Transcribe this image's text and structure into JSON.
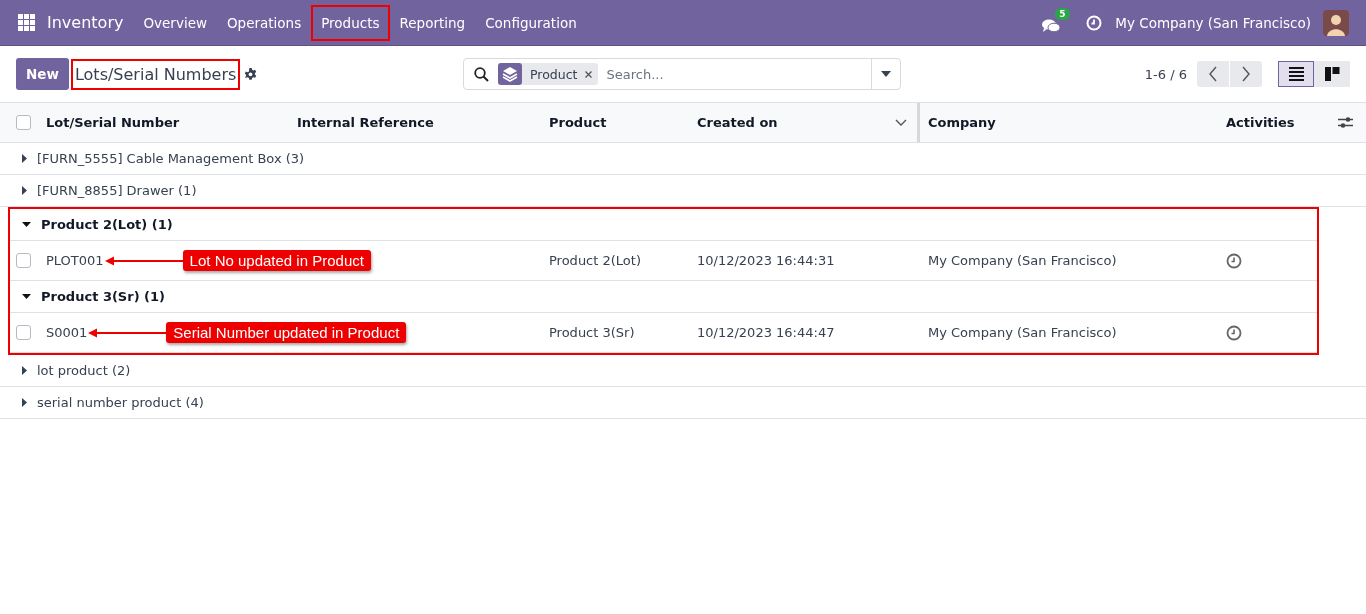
{
  "navbar": {
    "app": "Inventory",
    "menu": [
      {
        "label": "Overview",
        "highlighted": false
      },
      {
        "label": "Operations",
        "highlighted": false
      },
      {
        "label": "Products",
        "highlighted": true
      },
      {
        "label": "Reporting",
        "highlighted": false
      },
      {
        "label": "Configuration",
        "highlighted": false
      }
    ],
    "messages_badge": "5",
    "company": "My Company (San Francisco)"
  },
  "control_panel": {
    "new_button": "New",
    "title": "Lots/Serial Numbers",
    "title_highlighted": true,
    "search": {
      "facet": "Product",
      "placeholder": "Search..."
    },
    "pager": "1-6 / 6",
    "views": [
      {
        "kind": "list",
        "selected": true
      },
      {
        "kind": "kanban",
        "selected": false
      }
    ]
  },
  "table": {
    "select_all_checked": false,
    "columns": [
      "Lot/Serial Number",
      "Internal Reference",
      "Product",
      "Created on",
      "Company",
      "Activities"
    ],
    "groups": [
      {
        "label": "[FURN_5555] Cable Management Box (3)",
        "expanded": false,
        "highlighted": false
      },
      {
        "label": "[FURN_8855] Drawer (1)",
        "expanded": false,
        "highlighted": false
      },
      {
        "label": "Product 2(Lot) (1)",
        "expanded": true,
        "highlighted": true,
        "records": [
          {
            "lot": "PLOT001",
            "product": "Product 2(Lot)",
            "created_on": "10/12/2023 16:44:31",
            "company": "My Company (San Francisco)",
            "checked": false,
            "note": "Lot No updated in Product"
          }
        ]
      },
      {
        "label": "Product 3(Sr) (1)",
        "expanded": true,
        "highlighted": true,
        "records": [
          {
            "lot": "S0001",
            "product": "Product 3(Sr)",
            "created_on": "10/12/2023 16:44:47",
            "company": "My Company (San Francisco)",
            "checked": false,
            "note": "Serial Number updated in Product"
          }
        ]
      },
      {
        "label": "lot product (2)",
        "expanded": false,
        "highlighted": false
      },
      {
        "label": "serial number product (4)",
        "expanded": false,
        "highlighted": false
      }
    ]
  }
}
